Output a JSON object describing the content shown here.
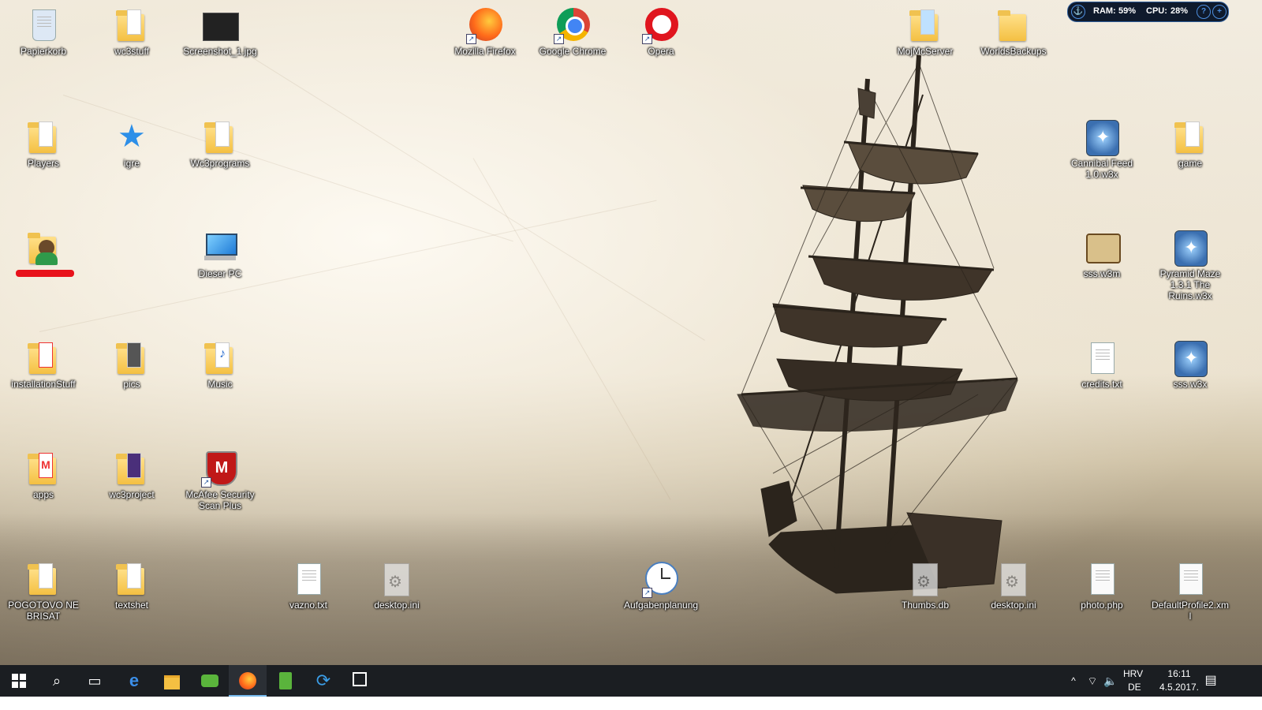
{
  "desktop": {
    "icons": [
      {
        "id": "recycle",
        "label": "Papierkorb"
      },
      {
        "id": "wc3stuff",
        "label": "wc3stuff"
      },
      {
        "id": "screenshot",
        "label": "Screenshot_1.jpg"
      },
      {
        "id": "firefox",
        "label": "Mozilla Firefox"
      },
      {
        "id": "chrome",
        "label": "Google Chrome"
      },
      {
        "id": "opera",
        "label": "Opera"
      },
      {
        "id": "mojmc",
        "label": "MojMcServer"
      },
      {
        "id": "worldsbackups",
        "label": "WorldsBackups"
      },
      {
        "id": "players",
        "label": "Players"
      },
      {
        "id": "igre",
        "label": "igre"
      },
      {
        "id": "wc3programs",
        "label": "Wc3programs"
      },
      {
        "id": "cannibal",
        "label": "Cannibal Feed 1.0.w3x"
      },
      {
        "id": "game",
        "label": "game"
      },
      {
        "id": "userfolder",
        "label": ""
      },
      {
        "id": "thispc",
        "label": "Dieser PC"
      },
      {
        "id": "sssw3m",
        "label": "sss.w3m"
      },
      {
        "id": "pyramid",
        "label": "Pyramid Maze 1.3.1 The Ruins.w3x"
      },
      {
        "id": "installation",
        "label": "installationStuff"
      },
      {
        "id": "pics",
        "label": "pics"
      },
      {
        "id": "music",
        "label": "Music"
      },
      {
        "id": "credits",
        "label": "credits.txt"
      },
      {
        "id": "sssw3x",
        "label": "sss.w3x"
      },
      {
        "id": "apps",
        "label": "apps"
      },
      {
        "id": "wc3project",
        "label": "wc3project"
      },
      {
        "id": "mcafee",
        "label": "McAfee Security Scan Plus"
      },
      {
        "id": "pogotovo",
        "label": "POGOTOVO NE BRISAT"
      },
      {
        "id": "textshet",
        "label": "textshet"
      },
      {
        "id": "vazno",
        "label": "vazno.txt"
      },
      {
        "id": "desktopini1",
        "label": "desktop.ini"
      },
      {
        "id": "aufgaben",
        "label": "Aufgabenplanung"
      },
      {
        "id": "thumbs",
        "label": "Thumbs.db"
      },
      {
        "id": "desktopini2",
        "label": "desktop.ini"
      },
      {
        "id": "photophp",
        "label": "photo.php"
      },
      {
        "id": "defaultprofile",
        "label": "DefaultProfile2.xml"
      }
    ]
  },
  "meter": {
    "ram_label": "RAM:",
    "ram_value": "59%",
    "cpu_label": "CPU:",
    "cpu_value": "28%"
  },
  "taskbar": {
    "language": "HRV",
    "keyboard": "DE",
    "time": "16:11",
    "date": "4.5.2017."
  }
}
